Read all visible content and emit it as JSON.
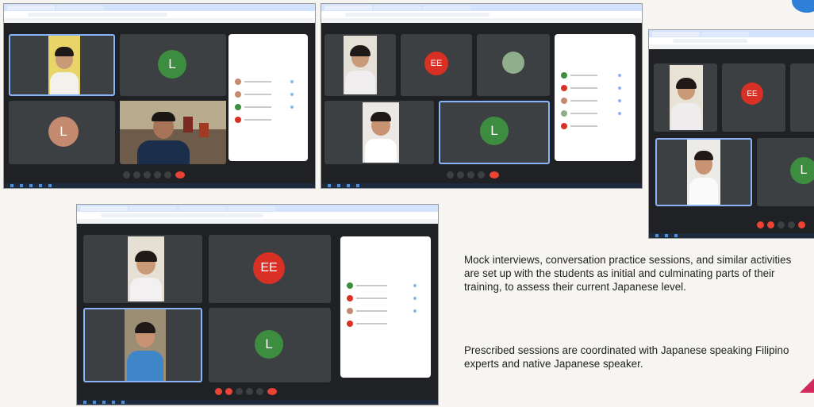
{
  "caption": {
    "paragraph1": "Mock interviews, conversation practice sessions, and similar activities are set up with the students as initial and culminating parts of their training, to assess their current Japanese level.",
    "paragraph2": "Prescribed sessions are coordinated with Japanese speaking Filipino experts and native Japanese speaker."
  },
  "avatars": {
    "l": "L",
    "ee": "EE"
  },
  "colors": {
    "avatar_green": "#3c8d3f",
    "avatar_red": "#d93025",
    "avatar_tan": "#c48a6f",
    "meet_bg": "#202124",
    "selected_border": "#8ab4f8",
    "hangup": "#ea4335",
    "accent_blue": "#2f80d9",
    "accent_pink": "#d2295a"
  }
}
